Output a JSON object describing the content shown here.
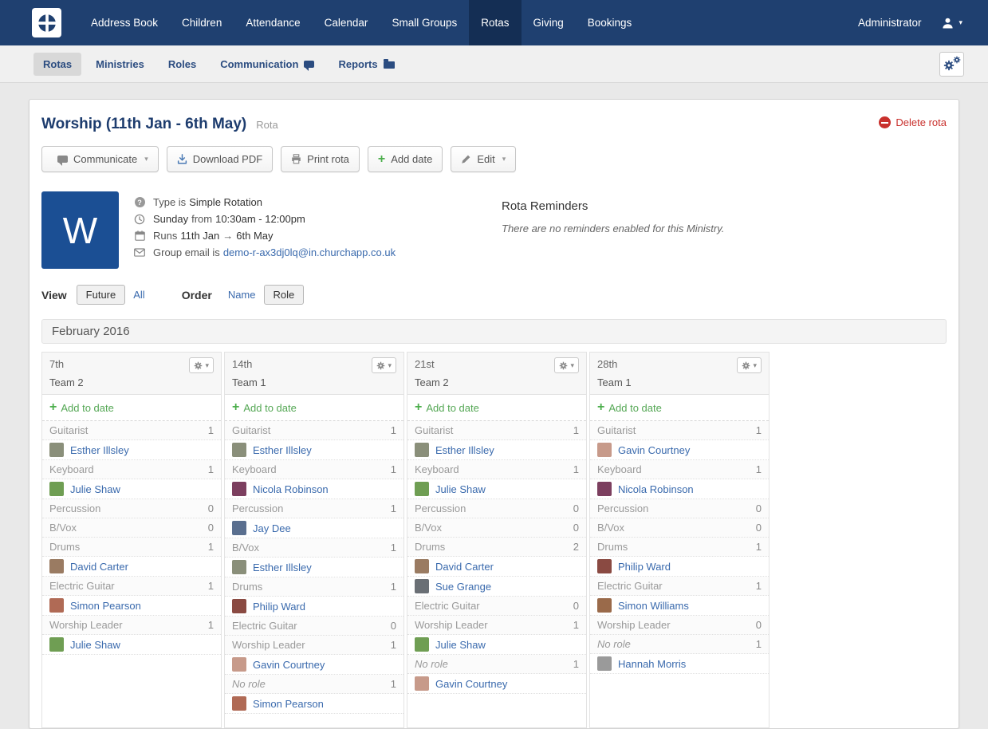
{
  "colors": {
    "navbar": "#1f4070",
    "navbar_active": "#142e54",
    "brand": "#1b4f94",
    "title": "#1d3c6e",
    "link": "#3a6aad",
    "subnav_link": "#2b4c80",
    "green": "#54a754",
    "red": "#c9302c"
  },
  "topnav": {
    "items": [
      {
        "label": "Address Book",
        "active": false
      },
      {
        "label": "Children",
        "active": false
      },
      {
        "label": "Attendance",
        "active": false
      },
      {
        "label": "Calendar",
        "active": false
      },
      {
        "label": "Small Groups",
        "active": false
      },
      {
        "label": "Rotas",
        "active": true
      },
      {
        "label": "Giving",
        "active": false
      },
      {
        "label": "Bookings",
        "active": false
      }
    ],
    "user_label": "Administrator"
  },
  "subnav": {
    "items": [
      {
        "label": "Rotas",
        "active": true,
        "icon": ""
      },
      {
        "label": "Ministries",
        "active": false,
        "icon": ""
      },
      {
        "label": "Roles",
        "active": false,
        "icon": ""
      },
      {
        "label": "Communication",
        "active": false,
        "icon": "speech"
      },
      {
        "label": "Reports",
        "active": false,
        "icon": "folder"
      }
    ]
  },
  "header": {
    "title": "Worship (11th Jan - 6th May)",
    "subtitle": "Rota",
    "delete_label": "Delete rota"
  },
  "toolbar": {
    "communicate_label": "Communicate",
    "download_label": "Download PDF",
    "print_label": "Print rota",
    "add_date_label": "Add date",
    "edit_label": "Edit"
  },
  "ministry": {
    "avatar_letter": "W",
    "type_prefix": "Type is",
    "type_value": "Simple Rotation",
    "time_day": "Sunday",
    "time_join": "from",
    "time_value": "10:30am - 12:00pm",
    "runs_prefix": "Runs",
    "runs_start": "11th Jan",
    "runs_arrow": "→",
    "runs_end": "6th May",
    "email_prefix": "Group email is",
    "email": "demo-r-ax3dj0lq@in.churchapp.co.uk"
  },
  "reminders": {
    "title": "Rota Reminders",
    "empty_text": "There are no reminders enabled for this Ministry."
  },
  "filters": {
    "view_label": "View",
    "view_options": [
      {
        "label": "Future",
        "active": true
      },
      {
        "label": "All",
        "active": false
      }
    ],
    "order_label": "Order",
    "order_options": [
      {
        "label": "Name",
        "active": false
      },
      {
        "label": "Role",
        "active": true
      }
    ]
  },
  "month_header": "February 2016",
  "columns": [
    {
      "date": "7th",
      "team": "Team 2",
      "add_label": "Add to date",
      "rows": [
        {
          "type": "role",
          "label": "Guitarist",
          "count": 1
        },
        {
          "type": "person",
          "name": "Esther Illsley",
          "avatar": "#8a8f7a"
        },
        {
          "type": "role",
          "label": "Keyboard",
          "count": 1
        },
        {
          "type": "person",
          "name": "Julie Shaw",
          "avatar": "#6f9e53"
        },
        {
          "type": "role",
          "label": "Percussion",
          "count": 0
        },
        {
          "type": "role",
          "label": "B/Vox",
          "count": 0
        },
        {
          "type": "role",
          "label": "Drums",
          "count": 1
        },
        {
          "type": "person",
          "name": "David Carter",
          "avatar": "#9a7b62"
        },
        {
          "type": "role",
          "label": "Electric Guitar",
          "count": 1
        },
        {
          "type": "person",
          "name": "Simon Pearson",
          "avatar": "#b06a55"
        },
        {
          "type": "role",
          "label": "Worship Leader",
          "count": 1
        },
        {
          "type": "person",
          "name": "Julie Shaw",
          "avatar": "#6f9e53"
        }
      ]
    },
    {
      "date": "14th",
      "team": "Team 1",
      "add_label": "Add to date",
      "rows": [
        {
          "type": "role",
          "label": "Guitarist",
          "count": 1
        },
        {
          "type": "person",
          "name": "Esther Illsley",
          "avatar": "#8a8f7a"
        },
        {
          "type": "role",
          "label": "Keyboard",
          "count": 1
        },
        {
          "type": "person",
          "name": "Nicola Robinson",
          "avatar": "#7c3f5f"
        },
        {
          "type": "role",
          "label": "Percussion",
          "count": 1
        },
        {
          "type": "person",
          "name": "Jay Dee",
          "avatar": "#5a6f8f"
        },
        {
          "type": "role",
          "label": "B/Vox",
          "count": 1
        },
        {
          "type": "person",
          "name": "Esther Illsley",
          "avatar": "#8a8f7a"
        },
        {
          "type": "role",
          "label": "Drums",
          "count": 1
        },
        {
          "type": "person",
          "name": "Philip Ward",
          "avatar": "#8a4a42"
        },
        {
          "type": "role",
          "label": "Electric Guitar",
          "count": 0
        },
        {
          "type": "role",
          "label": "Worship Leader",
          "count": 1
        },
        {
          "type": "person",
          "name": "Gavin Courtney",
          "avatar": "#c79a8a"
        },
        {
          "type": "role",
          "label": "No role",
          "count": 1,
          "italic": true
        },
        {
          "type": "person",
          "name": "Simon Pearson",
          "avatar": "#b06a55"
        }
      ]
    },
    {
      "date": "21st",
      "team": "Team 2",
      "add_label": "Add to date",
      "rows": [
        {
          "type": "role",
          "label": "Guitarist",
          "count": 1
        },
        {
          "type": "person",
          "name": "Esther Illsley",
          "avatar": "#8a8f7a"
        },
        {
          "type": "role",
          "label": "Keyboard",
          "count": 1
        },
        {
          "type": "person",
          "name": "Julie Shaw",
          "avatar": "#6f9e53"
        },
        {
          "type": "role",
          "label": "Percussion",
          "count": 0
        },
        {
          "type": "role",
          "label": "B/Vox",
          "count": 0
        },
        {
          "type": "role",
          "label": "Drums",
          "count": 2
        },
        {
          "type": "person",
          "name": "David Carter",
          "avatar": "#9a7b62"
        },
        {
          "type": "person",
          "name": "Sue Grange",
          "avatar": "#6a6f75"
        },
        {
          "type": "role",
          "label": "Electric Guitar",
          "count": 0
        },
        {
          "type": "role",
          "label": "Worship Leader",
          "count": 1
        },
        {
          "type": "person",
          "name": "Julie Shaw",
          "avatar": "#6f9e53"
        },
        {
          "type": "role",
          "label": "No role",
          "count": 1,
          "italic": true
        },
        {
          "type": "person",
          "name": "Gavin Courtney",
          "avatar": "#c79a8a"
        }
      ]
    },
    {
      "date": "28th",
      "team": "Team 1",
      "add_label": "Add to date",
      "rows": [
        {
          "type": "role",
          "label": "Guitarist",
          "count": 1
        },
        {
          "type": "person",
          "name": "Gavin Courtney",
          "avatar": "#c79a8a"
        },
        {
          "type": "role",
          "label": "Keyboard",
          "count": 1
        },
        {
          "type": "person",
          "name": "Nicola Robinson",
          "avatar": "#7c3f5f"
        },
        {
          "type": "role",
          "label": "Percussion",
          "count": 0
        },
        {
          "type": "role",
          "label": "B/Vox",
          "count": 0
        },
        {
          "type": "role",
          "label": "Drums",
          "count": 1
        },
        {
          "type": "person",
          "name": "Philip Ward",
          "avatar": "#8a4a42"
        },
        {
          "type": "role",
          "label": "Electric Guitar",
          "count": 1
        },
        {
          "type": "person",
          "name": "Simon Williams",
          "avatar": "#9a6a4a"
        },
        {
          "type": "role",
          "label": "Worship Leader",
          "count": 0
        },
        {
          "type": "role",
          "label": "No role",
          "count": 1,
          "italic": true
        },
        {
          "type": "person",
          "name": "Hannah Morris",
          "avatar": "#9a9a9a"
        }
      ]
    }
  ]
}
